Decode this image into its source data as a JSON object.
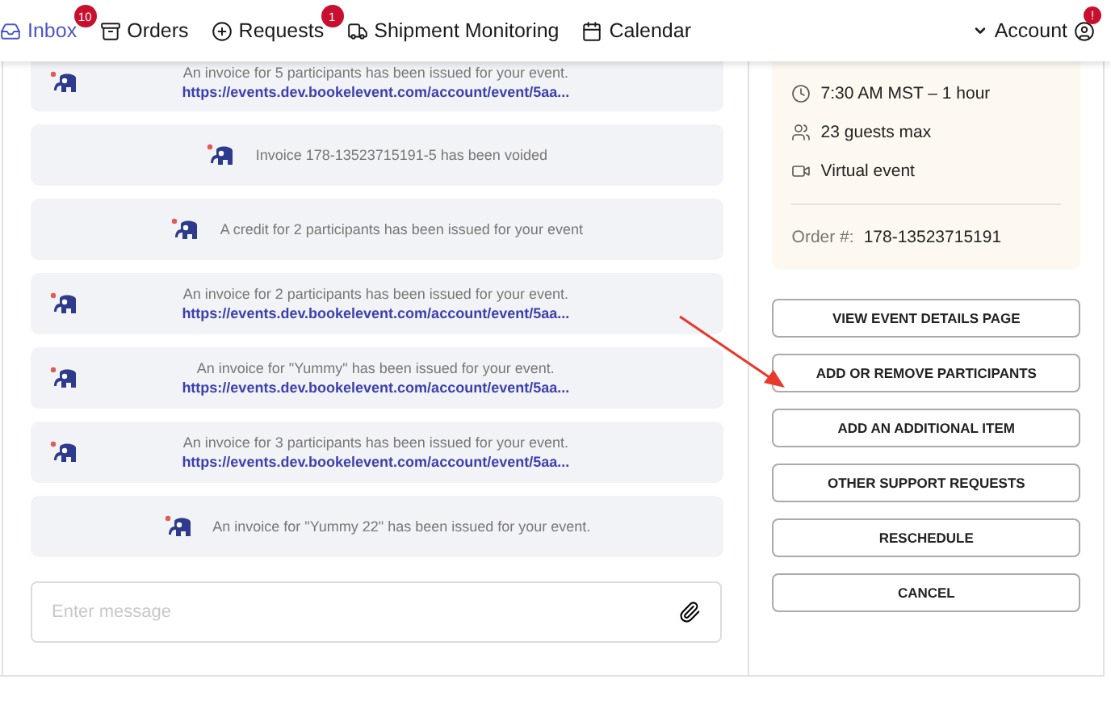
{
  "nav": {
    "items": [
      {
        "kind": "inbox",
        "label": "Inbox",
        "selected": true,
        "badge": "10"
      },
      {
        "kind": "orders",
        "label": "Orders",
        "selected": false
      },
      {
        "kind": "requests",
        "label": "Requests",
        "selected": false,
        "badge": "1"
      },
      {
        "kind": "shipment",
        "label": "Shipment Monitoring",
        "selected": false
      },
      {
        "kind": "calendar",
        "label": "Calendar",
        "selected": false
      }
    ],
    "account": {
      "label": "Account",
      "badge": "!"
    }
  },
  "messages": [
    {
      "text": "An invoice for 5 participants has been issued for your event.",
      "link": "https://events.dev.bookelevent.com/account/event/5aa..."
    },
    {
      "text": "Invoice 178-13523715191-5 has been voided"
    },
    {
      "text": "A credit for 2 participants has been issued for your event"
    },
    {
      "text": "An invoice for 2 participants has been issued for your event.",
      "link": "https://events.dev.bookelevent.com/account/event/5aa..."
    },
    {
      "text": "An invoice for \"Yummy\" has been issued for your event.",
      "link": "https://events.dev.bookelevent.com/account/event/5aa..."
    },
    {
      "text": "An invoice for 3 participants has been issued for your event.",
      "link": "https://events.dev.bookelevent.com/account/event/5aa..."
    },
    {
      "text": "An invoice for \"Yummy 22\" has been issued for your event."
    }
  ],
  "composer": {
    "placeholder": "Enter message"
  },
  "event": {
    "details": [
      {
        "kind": "time",
        "text": "7:30 AM MST – 1 hour"
      },
      {
        "kind": "guests",
        "text": "23 guests max"
      },
      {
        "kind": "video",
        "text": "Virtual event"
      }
    ],
    "order_label": "Order #:",
    "order_number": "178-13523715191"
  },
  "actions": [
    "VIEW EVENT DETAILS PAGE",
    "ADD OR REMOVE PARTICIPANTS",
    "ADD AN ADDITIONAL ITEM",
    "OTHER SUPPORT REQUESTS",
    "RESCHEDULE",
    "CANCEL"
  ]
}
